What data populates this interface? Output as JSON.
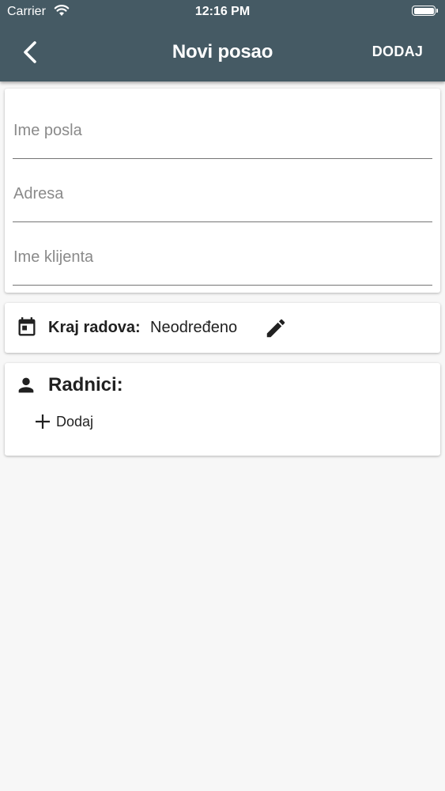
{
  "status_bar": {
    "carrier": "Carrier",
    "time": "12:16 PM"
  },
  "header": {
    "title": "Novi posao",
    "action_label": "DODAJ",
    "back_icon": "chevron-left-icon"
  },
  "form": {
    "fields": [
      {
        "placeholder": "Ime posla",
        "value": ""
      },
      {
        "placeholder": "Adresa",
        "value": ""
      },
      {
        "placeholder": "Ime klijenta",
        "value": ""
      }
    ]
  },
  "end_date": {
    "label": "Kraj radova:",
    "value": "Neodređeno",
    "icon": "calendar-icon",
    "edit_icon": "pencil-icon"
  },
  "workers": {
    "title": "Radnici:",
    "icon": "person-icon",
    "add_label": "Dodaj"
  },
  "colors": {
    "header_bg": "#455a64",
    "background": "#f7f7f7",
    "card_bg": "#ffffff",
    "text": "#212121",
    "placeholder": "#8a8a8a"
  }
}
